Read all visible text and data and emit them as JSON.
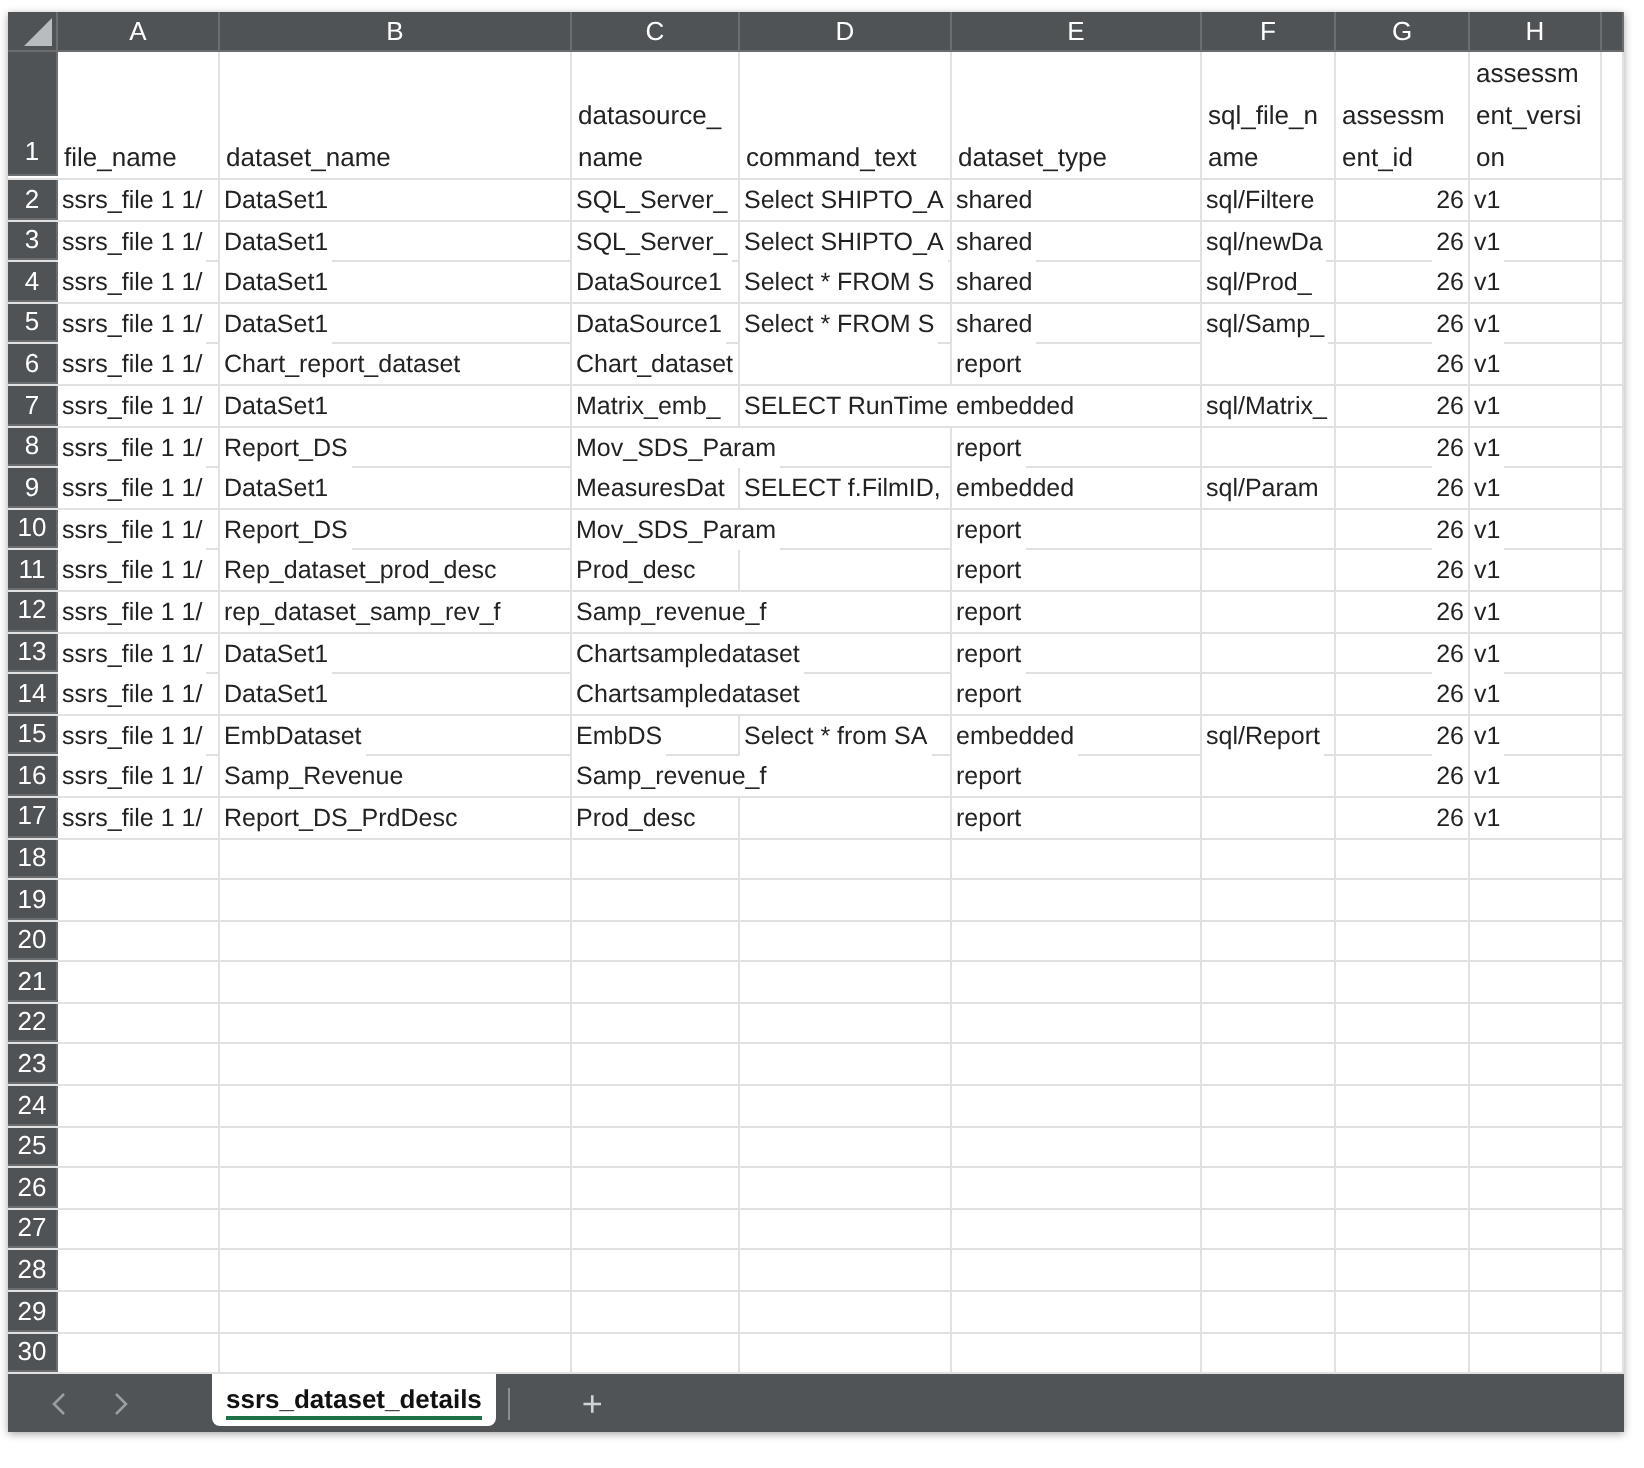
{
  "columns": [
    "A",
    "B",
    "C",
    "D",
    "E",
    "F",
    "G",
    "H"
  ],
  "header_row": {
    "number": "1",
    "cells": [
      [
        "file_name"
      ],
      [
        "dataset_name"
      ],
      [
        "datasource_",
        "name"
      ],
      [
        "command_text"
      ],
      [
        "dataset_type"
      ],
      [
        "sql_file_n",
        "ame"
      ],
      [
        "assessm",
        "ent_id"
      ],
      [
        "assessm",
        "ent_versi",
        "on"
      ]
    ]
  },
  "rows": [
    {
      "number": "2",
      "cells": [
        "ssrs_file 1 1/",
        "DataSet1",
        "SQL_Server_",
        "Select SHIPTO_A",
        "shared",
        "sql/Filtere",
        "26",
        "v1"
      ]
    },
    {
      "number": "3",
      "cells": [
        "ssrs_file 1 1/",
        "DataSet1",
        "SQL_Server_",
        "Select SHIPTO_A",
        "shared",
        "sql/newDa",
        "26",
        "v1"
      ]
    },
    {
      "number": "4",
      "cells": [
        "ssrs_file 1 1/",
        "DataSet1",
        "DataSource1",
        "Select * FROM S",
        "shared",
        "sql/Prod_",
        "26",
        "v1"
      ]
    },
    {
      "number": "5",
      "cells": [
        "ssrs_file 1 1/",
        "DataSet1",
        "DataSource1",
        "Select * FROM S",
        "shared",
        "sql/Samp_",
        "26",
        "v1"
      ]
    },
    {
      "number": "6",
      "cells": [
        "ssrs_file 1 1/",
        "Chart_report_dataset",
        "Chart_dataset",
        "",
        "report",
        "",
        "26",
        "v1"
      ]
    },
    {
      "number": "7",
      "cells": [
        "ssrs_file 1 1/",
        "DataSet1",
        "Matrix_emb_",
        "SELECT RunTime",
        "embedded",
        "sql/Matrix_",
        "26",
        "v1"
      ]
    },
    {
      "number": "8",
      "cells": [
        "ssrs_file 1 1/",
        "Report_DS",
        "Mov_SDS_Param",
        "",
        "report",
        "",
        "26",
        "v1"
      ]
    },
    {
      "number": "9",
      "cells": [
        "ssrs_file 1 1/",
        "DataSet1",
        "MeasuresDat",
        "SELECT f.FilmID,",
        "embedded",
        "sql/Param",
        "26",
        "v1"
      ]
    },
    {
      "number": "10",
      "cells": [
        "ssrs_file 1 1/",
        "Report_DS",
        "Mov_SDS_Param",
        "",
        "report",
        "",
        "26",
        "v1"
      ]
    },
    {
      "number": "11",
      "cells": [
        "ssrs_file 1 1/",
        "Rep_dataset_prod_desc",
        "Prod_desc",
        "",
        "report",
        "",
        "26",
        "v1"
      ]
    },
    {
      "number": "12",
      "cells": [
        "ssrs_file 1 1/",
        "rep_dataset_samp_rev_f",
        "Samp_revenue_f",
        "",
        "report",
        "",
        "26",
        "v1"
      ]
    },
    {
      "number": "13",
      "cells": [
        "ssrs_file 1 1/",
        "DataSet1",
        "Chartsampledataset",
        "",
        "report",
        "",
        "26",
        "v1"
      ]
    },
    {
      "number": "14",
      "cells": [
        "ssrs_file 1 1/",
        "DataSet1",
        "Chartsampledataset",
        "",
        "report",
        "",
        "26",
        "v1"
      ]
    },
    {
      "number": "15",
      "cells": [
        "ssrs_file 1 1/",
        "EmbDataset",
        "EmbDS",
        "Select * from SA",
        "embedded",
        "sql/Report",
        "26",
        "v1"
      ]
    },
    {
      "number": "16",
      "cells": [
        "ssrs_file 1 1/",
        "Samp_Revenue",
        "Samp_revenue_f",
        "",
        "report",
        "",
        "26",
        "v1"
      ]
    },
    {
      "number": "17",
      "cells": [
        "ssrs_file 1 1/",
        "Report_DS_PrdDesc",
        "Prod_desc",
        "",
        "report",
        "",
        "26",
        "v1"
      ]
    }
  ],
  "empty_rows": [
    "18",
    "19",
    "20",
    "21",
    "22",
    "23",
    "24",
    "25",
    "26",
    "27",
    "28",
    "29",
    "30"
  ],
  "sheet_tabs": [
    {
      "label": "ssrs_dataset_details",
      "selected": true
    }
  ],
  "add_sheet": "+"
}
